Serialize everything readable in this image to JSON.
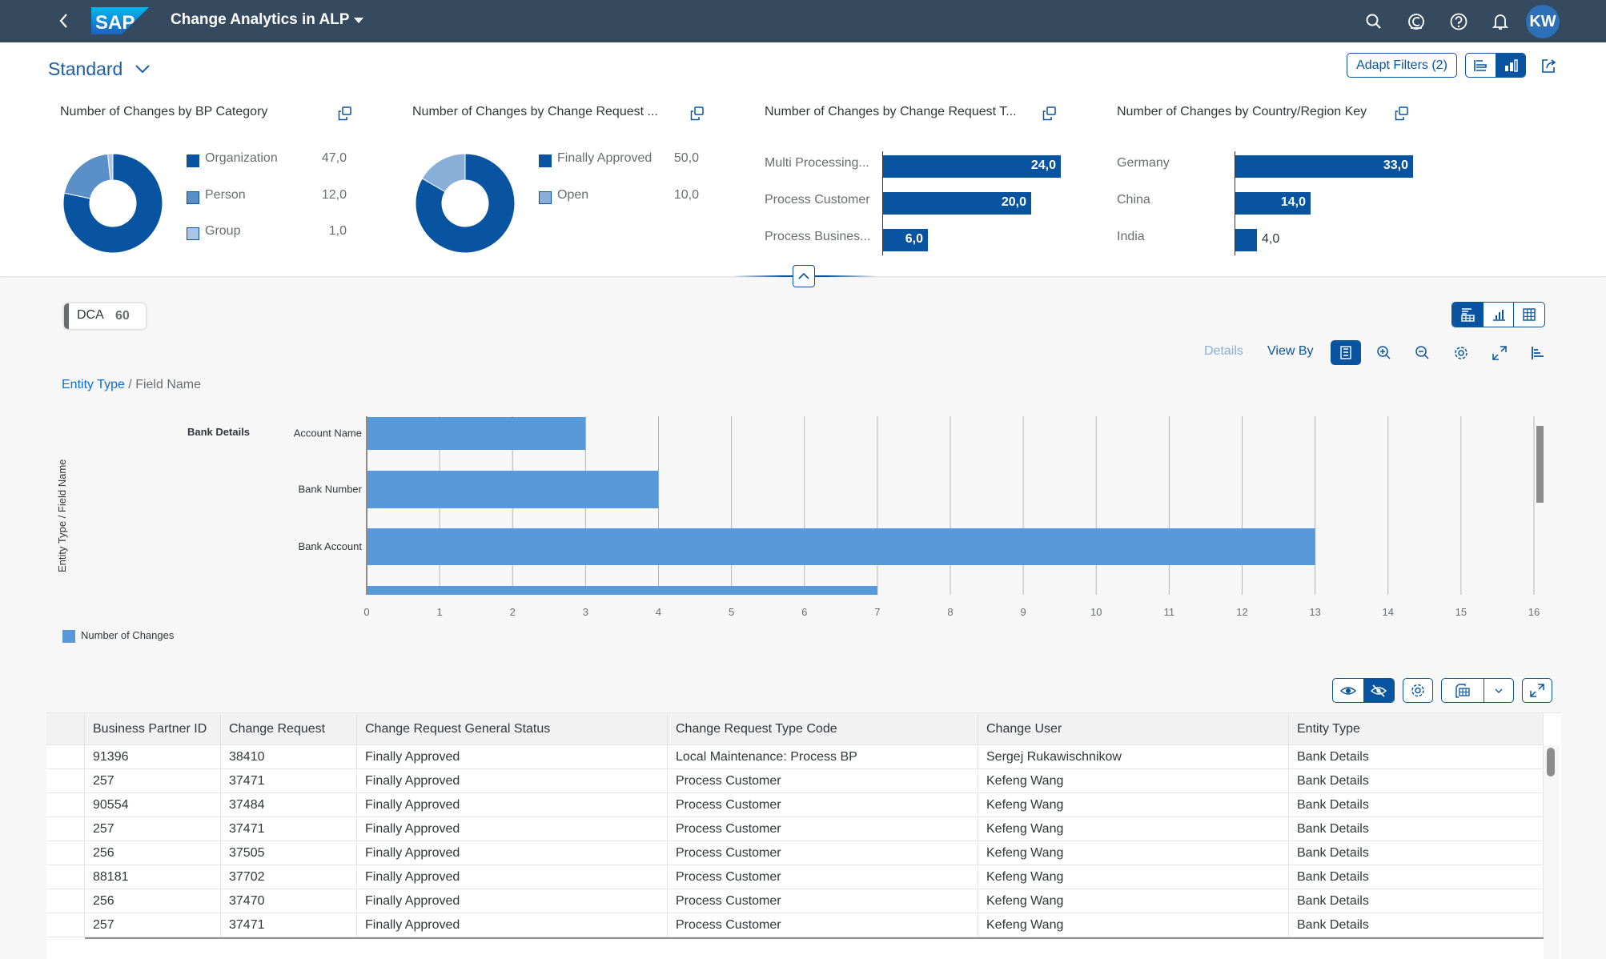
{
  "shell": {
    "title": "Change Analytics in ALP",
    "logo_text": "SAP",
    "avatar_initials": "KW",
    "icons": [
      "search-icon",
      "copilot-icon",
      "help-icon",
      "notification-icon"
    ]
  },
  "header": {
    "variant": "Standard",
    "adapt_filters": "Adapt Filters (2)",
    "view_toggle": [
      "visual-filter-bar",
      "compact-filter"
    ],
    "view_toggle_active": 1
  },
  "colors": {
    "brand": "#0854a0",
    "shell": "#354a5f",
    "chart_bar": "#5899da",
    "donut_dark": "#0854a0",
    "donut_mid": "#5b8fc7",
    "donut_light": "#a9c4e4"
  },
  "kpi_cards": [
    {
      "title": "Number of Changes by BP Category",
      "type": "donut",
      "items": [
        {
          "label": "Organization",
          "value": 47,
          "display": "47,0",
          "color": "#0854a0"
        },
        {
          "label": "Person",
          "value": 12,
          "display": "12,0",
          "color": "#5b8fc7"
        },
        {
          "label": "Group",
          "value": 1,
          "display": "1,0",
          "color": "#a9c4e4"
        }
      ]
    },
    {
      "title": "Number of Changes by Change Request ...",
      "type": "donut",
      "items": [
        {
          "label": "Finally Approved",
          "value": 50,
          "display": "50,0",
          "color": "#0854a0"
        },
        {
          "label": "Open",
          "value": 10,
          "display": "10,0",
          "color": "#8ab0d9"
        }
      ]
    },
    {
      "title": "Number of Changes by Change Request T...",
      "type": "bar",
      "max": 24,
      "items": [
        {
          "label": "Multi Processing...",
          "value": 24,
          "display": "24,0"
        },
        {
          "label": "Process Customer",
          "value": 20,
          "display": "20,0"
        },
        {
          "label": "Process Busines...",
          "value": 6,
          "display": "6,0"
        }
      ]
    },
    {
      "title": "Number of Changes by Country/Region Key",
      "type": "bar",
      "max": 33,
      "items": [
        {
          "label": "Germany",
          "value": 33,
          "display": "33,0"
        },
        {
          "label": "China",
          "value": 14,
          "display": "14,0"
        },
        {
          "label": "India",
          "value": 4,
          "display": "4,0"
        }
      ]
    }
  ],
  "dca_chip": {
    "label": "DCA",
    "value": "60"
  },
  "chart_toolbar": {
    "details": "Details",
    "view_by": "View By",
    "view_switch_active": 0
  },
  "breadcrumb": {
    "link": "Entity Type",
    "sep": " / ",
    "current": "Field Name"
  },
  "chart_data": {
    "type": "bar",
    "orientation": "horizontal",
    "title": "",
    "ylabel": "Entity Type / Field Name",
    "xlabel": "",
    "group": "Bank Details",
    "categories": [
      "Account Name",
      "Bank Number",
      "Bank Account",
      ""
    ],
    "series": [
      {
        "name": "Number of Changes",
        "values": [
          3,
          4,
          13,
          7
        ]
      }
    ],
    "xlim": [
      0,
      16
    ],
    "x_ticks": [
      "0",
      "1",
      "2",
      "3",
      "4",
      "5",
      "6",
      "7",
      "8",
      "9",
      "10",
      "11",
      "12",
      "13",
      "14",
      "15",
      "16"
    ],
    "grid": true,
    "legend": "bottom-left"
  },
  "table": {
    "columns": [
      "Business Partner ID",
      "Change Request",
      "Change Request General Status",
      "Change Request Type Code",
      "Change User",
      "Entity Type"
    ],
    "rows": [
      [
        "91396",
        "38410",
        "Finally Approved",
        "Local Maintenance: Process BP",
        "Sergej Rukawischnikow",
        "Bank Details"
      ],
      [
        "257",
        "37471",
        "Finally Approved",
        "Process Customer",
        "Kefeng Wang",
        "Bank Details"
      ],
      [
        "90554",
        "37484",
        "Finally Approved",
        "Process Customer",
        "Kefeng Wang",
        "Bank Details"
      ],
      [
        "257",
        "37471",
        "Finally Approved",
        "Process Customer",
        "Kefeng Wang",
        "Bank Details"
      ],
      [
        "256",
        "37505",
        "Finally Approved",
        "Process Customer",
        "Kefeng Wang",
        "Bank Details"
      ],
      [
        "88181",
        "37702",
        "Finally Approved",
        "Process Customer",
        "Kefeng Wang",
        "Bank Details"
      ],
      [
        "256",
        "37470",
        "Finally Approved",
        "Process Customer",
        "Kefeng Wang",
        "Bank Details"
      ],
      [
        "257",
        "37471",
        "Finally Approved",
        "Process Customer",
        "Kefeng Wang",
        "Bank Details"
      ]
    ]
  }
}
